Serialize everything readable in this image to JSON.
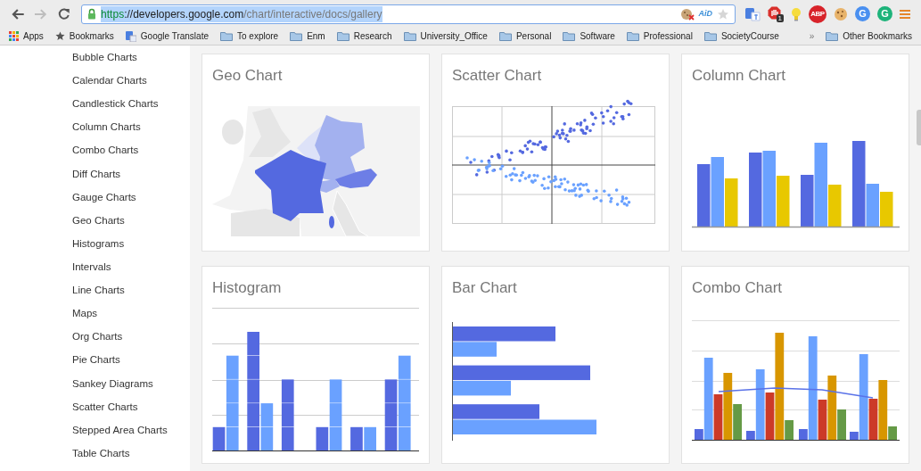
{
  "toolbar": {
    "forward_disabled": true,
    "address_bar": {
      "scheme": "https",
      "host": "://developers.google.com",
      "path": "/chart/interactive/docs/gallery",
      "selected": true,
      "badges": [
        {
          "kind": "cookie-blocked"
        },
        {
          "kind": "text",
          "text": "AiD"
        },
        {
          "kind": "star"
        }
      ]
    },
    "extensions": [
      {
        "kind": "translate"
      },
      {
        "kind": "stop",
        "badge": "1"
      },
      {
        "kind": "bulb"
      },
      {
        "kind": "abp",
        "text": "ABP"
      },
      {
        "kind": "cookie"
      },
      {
        "kind": "letter",
        "text": "G",
        "color": "#4a90f0"
      },
      {
        "kind": "letter",
        "text": "G",
        "color": "#1db37a"
      },
      {
        "kind": "menu"
      }
    ]
  },
  "bookmarks": [
    {
      "kind": "apps",
      "label": "Apps"
    },
    {
      "kind": "star",
      "label": "Bookmarks"
    },
    {
      "kind": "translate",
      "label": "Google Translate"
    },
    {
      "kind": "folder",
      "label": "To explore"
    },
    {
      "kind": "folder",
      "label": "Enm"
    },
    {
      "kind": "folder",
      "label": "Research"
    },
    {
      "kind": "folder",
      "label": "University_Office"
    },
    {
      "kind": "folder",
      "label": "Personal"
    },
    {
      "kind": "folder",
      "label": "Software"
    },
    {
      "kind": "folder",
      "label": "Professional"
    },
    {
      "kind": "folder",
      "label": "SocietyCourse"
    }
  ],
  "bookmarks_overflow": "»",
  "other_bookmarks": "Other Bookmarks",
  "sidebar": {
    "items": [
      "Bubble Charts",
      "Calendar Charts",
      "Candlestick Charts",
      "Column Charts",
      "Combo Charts",
      "Diff Charts",
      "Gauge Charts",
      "Geo Charts",
      "Histograms",
      "Intervals",
      "Line Charts",
      "Maps",
      "Org Charts",
      "Pie Charts",
      "Sankey Diagrams",
      "Scatter Charts",
      "Stepped Area Charts",
      "Table Charts"
    ]
  },
  "gallery": [
    {
      "title": "Geo Chart",
      "kind": "geo"
    },
    {
      "title": "Scatter Chart",
      "kind": "scatter"
    },
    {
      "title": "Column Chart",
      "kind": "column"
    },
    {
      "title": "Histogram",
      "kind": "histogram"
    },
    {
      "title": "Bar Chart",
      "kind": "bar"
    },
    {
      "title": "Combo Chart",
      "kind": "combo"
    }
  ]
}
